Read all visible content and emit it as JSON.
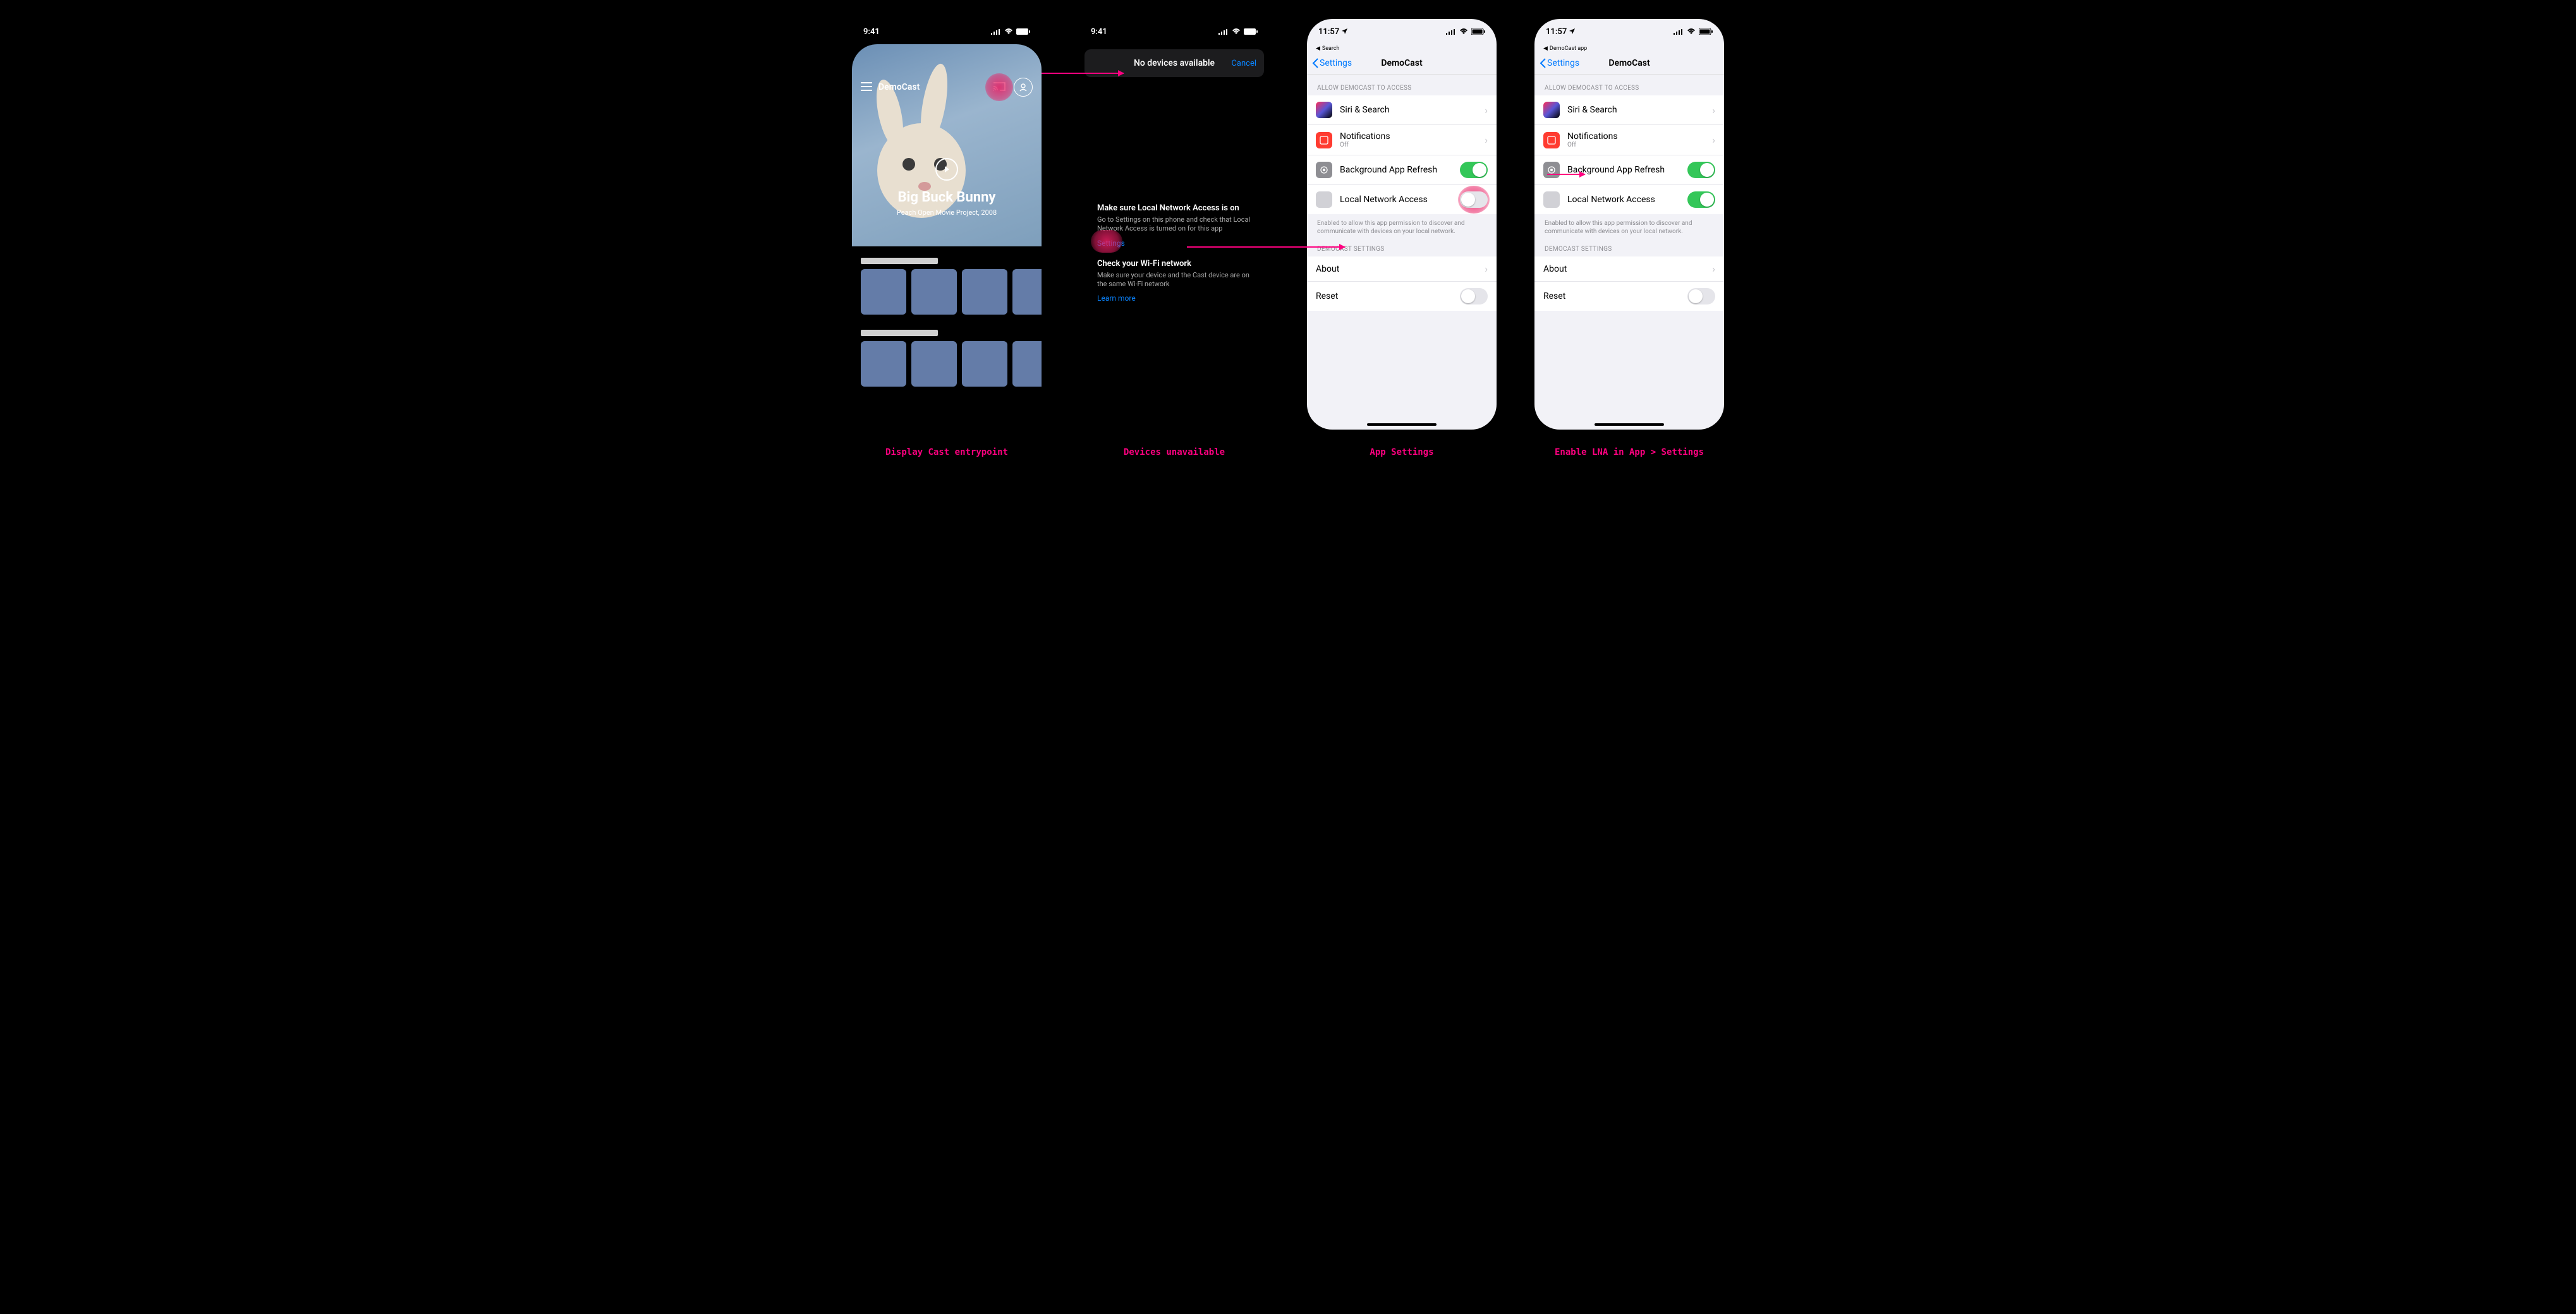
{
  "phone1": {
    "time": "9:41",
    "app_name": "DemoCast",
    "hero_title": "Big Buck Bunny",
    "hero_subtitle": "Peach Open Movie Project, 2008"
  },
  "phone2": {
    "time": "9:41",
    "sheet_title": "No devices available",
    "cancel": "Cancel",
    "tip1_title": "Make sure Local Network Access is on",
    "tip1_body": "Go to Settings on this phone and check that Local Network Access is turned on for this app",
    "tip1_link": "Settings",
    "tip2_title": "Check your Wi-Fi network",
    "tip2_body": "Make sure your device and the Cast device are on the same Wi-Fi network",
    "tip2_link": "Learn more"
  },
  "settings": {
    "time": "11:57",
    "back_label": "Settings",
    "title": "DemoCast",
    "breadcrumb_search": "Search",
    "breadcrumb_app": "DemoCast app",
    "section_access": "ALLOW DEMOCAST TO ACCESS",
    "siri": "Siri & Search",
    "notifications": "Notifications",
    "notifications_sub": "Off",
    "bg_refresh": "Background App Refresh",
    "lna": "Local Network Access",
    "lna_note": "Enabled to allow this app permission to discover and communicate with devices on your local network.",
    "section_app": "DEMOCAST SETTINGS",
    "about": "About",
    "reset": "Reset"
  },
  "captions": {
    "c1": "Display Cast entrypoint",
    "c2": "Devices unavailable",
    "c3": "App Settings",
    "c4": "Enable LNA in App > Settings"
  }
}
